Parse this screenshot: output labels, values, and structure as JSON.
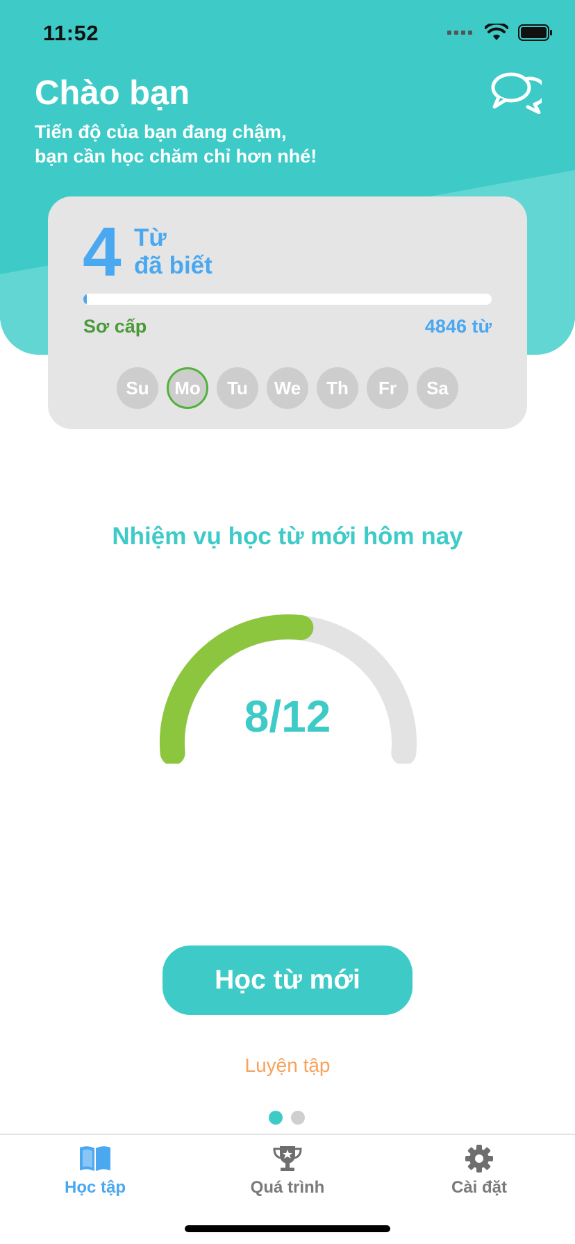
{
  "status_bar": {
    "time": "11:52"
  },
  "header": {
    "title": "Chào bạn",
    "subtitle_lines": [
      "Tiến độ của bạn đang chậm,",
      "bạn cần học chăm chỉ hơn nhé!"
    ],
    "chat_icon": "chat-bubbles-icon"
  },
  "stats": {
    "known_count": "4",
    "known_label_lines": [
      "Từ",
      "đã biết"
    ],
    "progress_fraction": 0.0008,
    "level": "Sơ cấp",
    "level_total": "4846 từ",
    "days": [
      {
        "label": "Su",
        "active": false
      },
      {
        "label": "Mo",
        "active": true
      },
      {
        "label": "Tu",
        "active": false
      },
      {
        "label": "We",
        "active": false
      },
      {
        "label": "Th",
        "active": false
      },
      {
        "label": "Fr",
        "active": false
      },
      {
        "label": "Sa",
        "active": false
      }
    ]
  },
  "task": {
    "title": "Nhiệm vụ học từ mới hôm nay",
    "done": 8,
    "total": 12,
    "display": "8/12"
  },
  "actions": {
    "primary_label": "Học từ mới",
    "secondary_label": "Luyện tập"
  },
  "pager": {
    "count": 2,
    "active_index": 0
  },
  "tabs": [
    {
      "label": "Học tập",
      "icon": "book-icon",
      "active": true
    },
    {
      "label": "Quá trình",
      "icon": "trophy-icon",
      "active": false
    },
    {
      "label": "Cài đặt",
      "icon": "gear-icon",
      "active": false
    }
  ],
  "colors": {
    "teal": "#3ecbc7",
    "blue": "#4aa8f0",
    "green": "#8cc63f",
    "orange": "#f7a35c"
  }
}
